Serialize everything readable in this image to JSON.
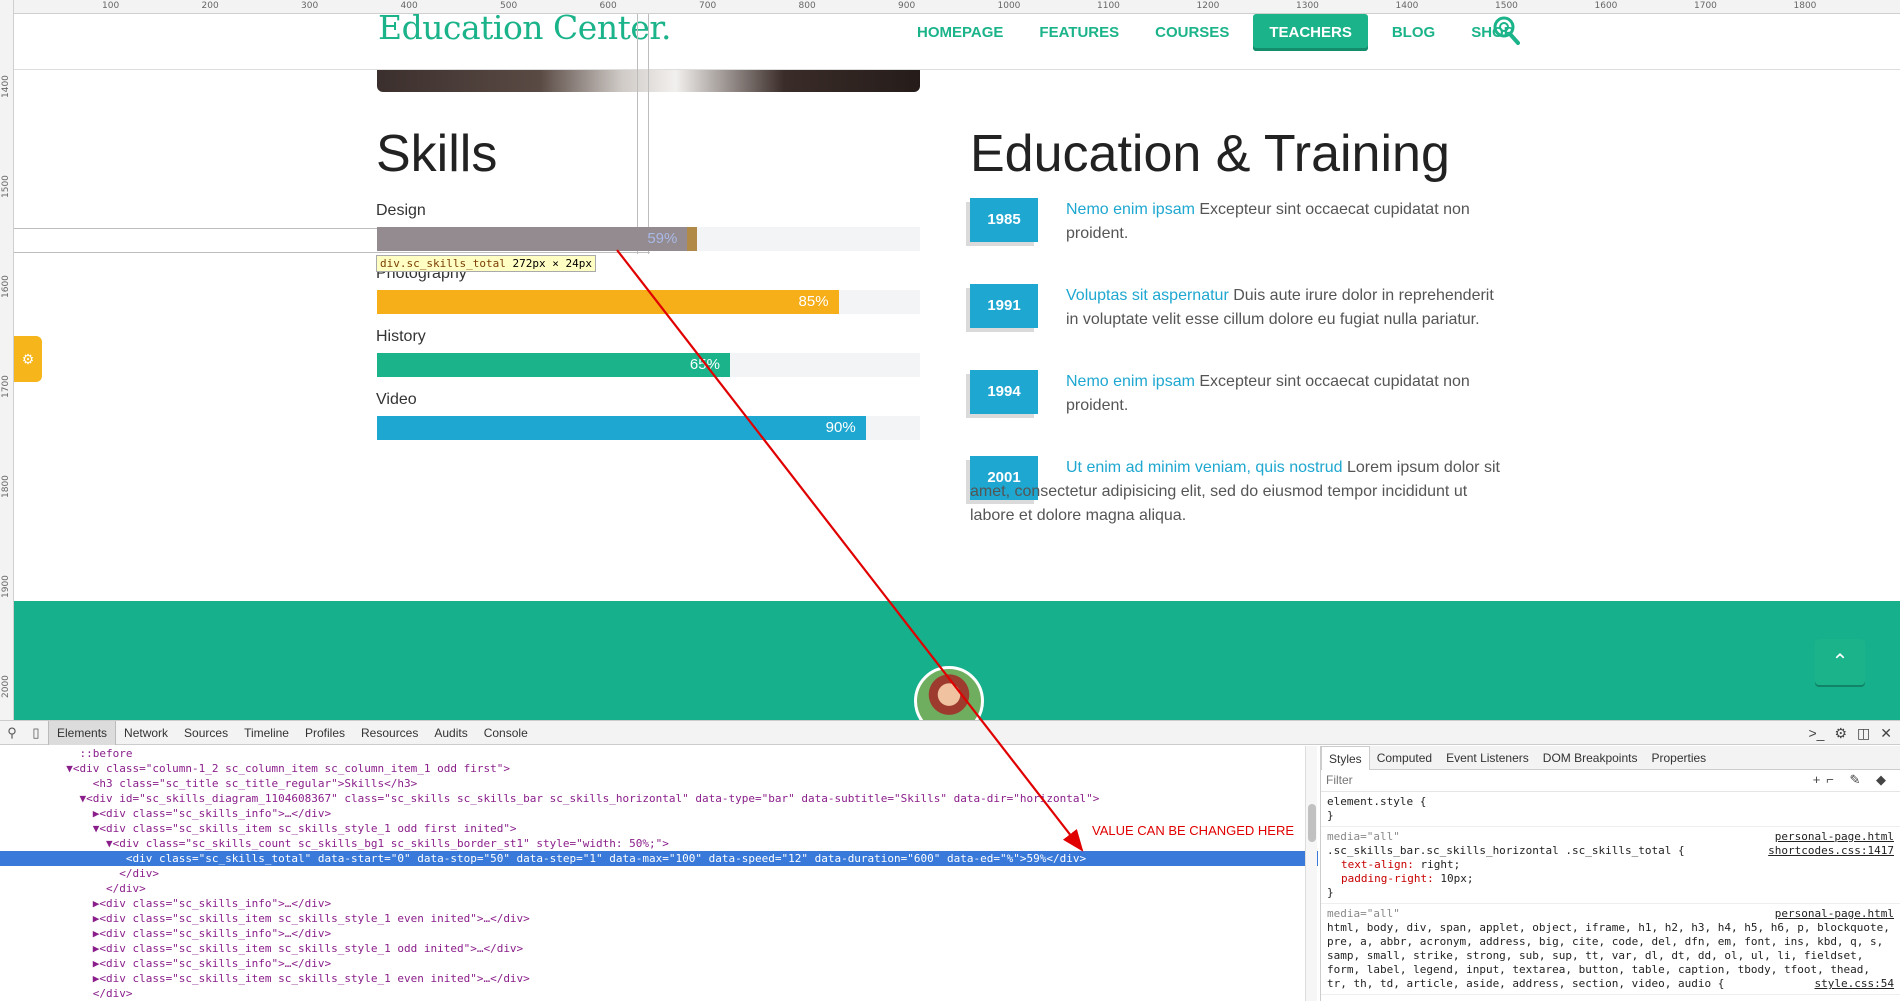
{
  "ruler": {
    "top_labels": [
      "100",
      "200",
      "300",
      "400",
      "500",
      "600",
      "700",
      "800",
      "900",
      "1000",
      "1100",
      "1200",
      "1300",
      "1400",
      "1500",
      "1600",
      "1700",
      "1800"
    ],
    "left_labels": [
      "1400",
      "1500",
      "1600",
      "1700",
      "1800",
      "1900",
      "2000"
    ]
  },
  "header": {
    "logo": "Education Center.",
    "nav": [
      "HOMEPAGE",
      "FEATURES",
      "COURSES",
      "TEACHERS",
      "BLOG",
      "SHOP"
    ],
    "active_nav": "TEACHERS"
  },
  "skills": {
    "title": "Skills",
    "items": [
      {
        "label": "Design",
        "value": 59,
        "display": "59%",
        "color": "#948b90",
        "accent": "#b08a46"
      },
      {
        "label": "Photography",
        "value": 85,
        "display": "85%",
        "color": "#f6ae19"
      },
      {
        "label": "History",
        "value": 65,
        "display": "65%",
        "color": "#1bb38a"
      },
      {
        "label": "Video",
        "value": 90,
        "display": "90%",
        "color": "#1ea7d0"
      }
    ]
  },
  "tooltip": {
    "selector": "div.sc_skills_total",
    "size": "272px × 24px"
  },
  "education": {
    "title": "Education & Training",
    "items": [
      {
        "year": "1985",
        "link": "Nemo enim ipsam",
        "text": " Excepteur sint occaecat cupidatat non proident."
      },
      {
        "year": "1991",
        "link": "Voluptas sit aspernatur",
        "text": " Duis aute irure dolor in reprehenderit in voluptate velit esse cillum dolore eu fugiat nulla pariatur."
      },
      {
        "year": "1994",
        "link": "Nemo enim ipsam",
        "text": " Excepteur sint occaecat cupidatat non proident."
      },
      {
        "year": "2001",
        "link": "Ut enim ad minim veniam, quis nostrud",
        "text": " Lorem ipsum dolor sit amet, consectetur adipisicing elit, sed do eiusmod tempor incididunt ut labore et dolore magna aliqua."
      }
    ]
  },
  "side_tab_icon": "gear-icon",
  "scroll_top_icon": "chevron-up-icon",
  "devtools": {
    "tabs": [
      "Elements",
      "Network",
      "Sources",
      "Timeline",
      "Profiles",
      "Resources",
      "Audits",
      "Console"
    ],
    "active_tab": "Elements",
    "dom_lines": [
      {
        "text": "            ::before"
      },
      {
        "text": "          ▼<div class=\"column-1_2 sc_column_item sc_column_item_1 odd first\">"
      },
      {
        "text": "              <h3 class=\"sc_title sc_title_regular\">Skills</h3>"
      },
      {
        "text": "            ▼<div id=\"sc_skills_diagram_1104608367\" class=\"sc_skills sc_skills_bar sc_skills_horizontal\" data-type=\"bar\" data-subtitle=\"Skills\" data-dir=\"horizontal\">"
      },
      {
        "text": "              ▶<div class=\"sc_skills_info\">…</div>"
      },
      {
        "text": "              ▼<div class=\"sc_skills_item sc_skills_style_1 odd first inited\">"
      },
      {
        "text": "                ▼<div class=\"sc_skills_count sc_skills_bg1 sc_skills_border_st1\" style=\"width: 50%;\">"
      },
      {
        "text": "                   <div class=\"sc_skills_total\" data-start=\"0\" data-stop=\"50\" data-step=\"1\" data-max=\"100\" data-speed=\"12\" data-duration=\"600\" data-ed=\"%\">59%</div>",
        "selected": true
      },
      {
        "text": "                  </div>"
      },
      {
        "text": "                </div>"
      },
      {
        "text": "              ▶<div class=\"sc_skills_info\">…</div>"
      },
      {
        "text": "              ▶<div class=\"sc_skills_item sc_skills_style_1 even inited\">…</div>"
      },
      {
        "text": "              ▶<div class=\"sc_skills_info\">…</div>"
      },
      {
        "text": "              ▶<div class=\"sc_skills_item sc_skills_style_1 odd inited\">…</div>"
      },
      {
        "text": "              ▶<div class=\"sc_skills_info\">…</div>"
      },
      {
        "text": "              ▶<div class=\"sc_skills_item sc_skills_style_1 even inited\">…</div>"
      },
      {
        "text": "              </div>"
      }
    ],
    "annotation": "VALUE CAN BE CHANGED HERE",
    "styles_tabs": [
      "Styles",
      "Computed",
      "Event Listeners",
      "DOM Breakpoints",
      "Properties"
    ],
    "active_styles_tab": "Styles",
    "filter_placeholder": "Filter",
    "css_blocks": [
      {
        "media": "",
        "selector": "element.style {",
        "props": [],
        "close": "}",
        "source": ""
      },
      {
        "media": "media=\"all\"",
        "selector": ".sc_skills_bar.sc_skills_horizontal .sc_skills_total {",
        "props": [
          "text-align: right;",
          "padding-right: 10px;"
        ],
        "close": "}",
        "source_media": "personal-page.html",
        "source": "shortcodes.css:1417"
      },
      {
        "media": "media=\"all\"",
        "selector": "html, body, div, span, applet, object, iframe, h1, h2, h3, h4, h5, h6, p, blockquote, pre, a, abbr, acronym, address, big, cite, code, del, dfn, em, font, ins, kbd, q, s, samp, small, strike, strong, sub, sup, tt, var, dl, dt, dd, ol, ul, li, fieldset, form, label, legend, input, textarea, button, table, caption, tbody, tfoot, thead, tr, th, td, article, aside, address, section, video, audio {",
        "props": [],
        "close": "",
        "source_media": "personal-page.html",
        "source": "style.css:54"
      }
    ]
  }
}
